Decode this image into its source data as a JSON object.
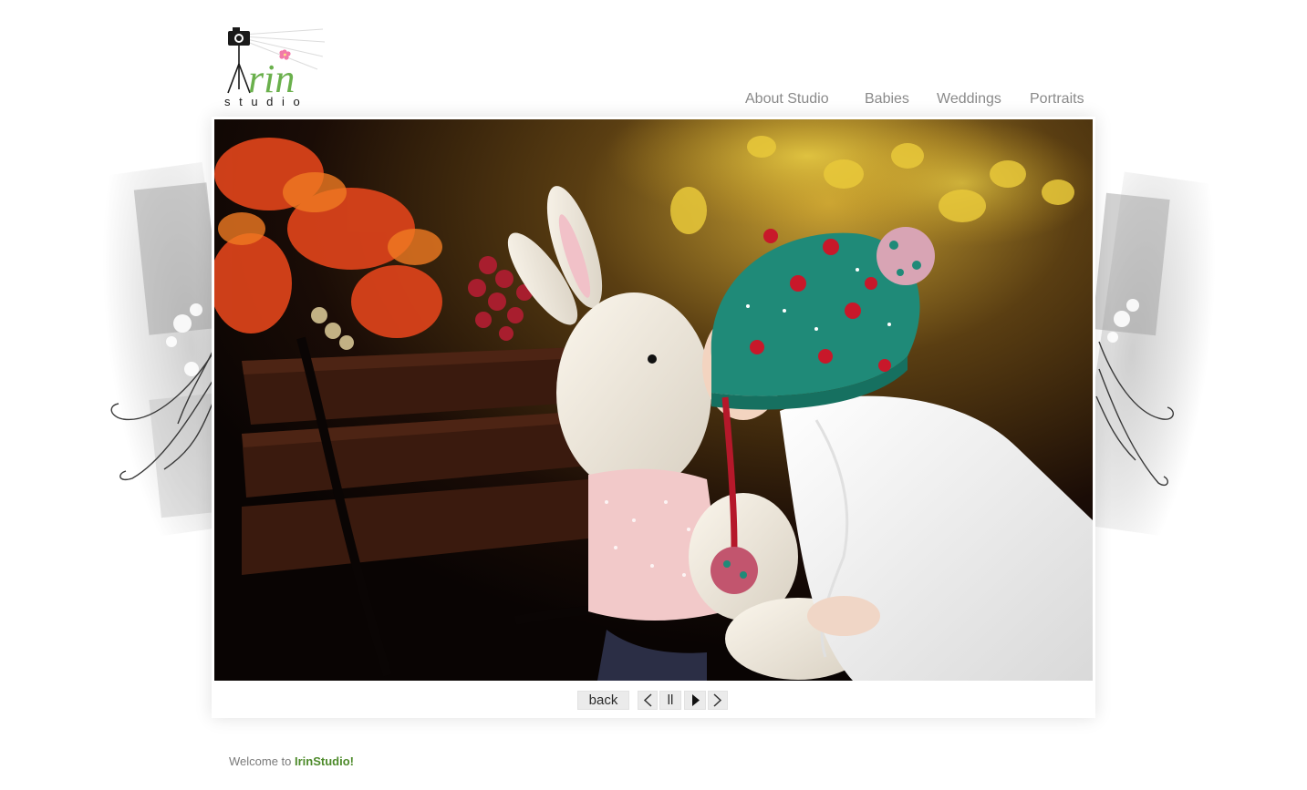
{
  "logo": {
    "brand_text": "rin",
    "subtitle_letters": "s t u d i o",
    "icon": "camera-tripod-icon"
  },
  "nav": {
    "items": [
      {
        "label": "About Studio"
      },
      {
        "label": "Babies"
      },
      {
        "label": "Weddings"
      },
      {
        "label": "Portraits"
      }
    ]
  },
  "controls": {
    "back_label": "back",
    "prev_icon": "chevron-left-icon",
    "pause_label": "ll",
    "play_icon": "play-icon",
    "next_icon": "chevron-right-icon"
  },
  "footer": {
    "welcome_prefix": "Welcome to ",
    "brand_name": "IrinStudio!"
  },
  "colors": {
    "brand_green": "#4d8a2a",
    "nav_gray": "#8a8a8a",
    "button_bg": "#ebebeb",
    "hat_teal": "#1f8a78"
  }
}
